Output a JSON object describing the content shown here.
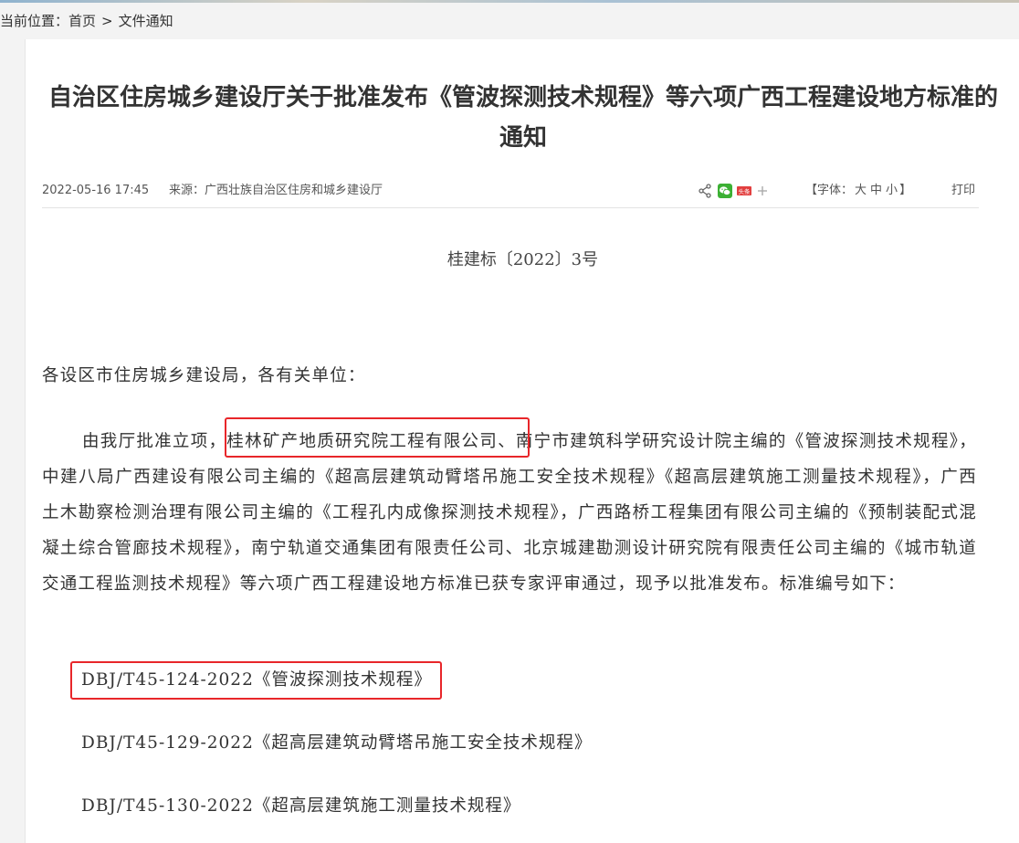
{
  "breadcrumb": {
    "label": "当前位置：",
    "home": "首页",
    "separator": ">",
    "current": "文件通知"
  },
  "article": {
    "title": "自治区住房城乡建设厅关于批准发布《管波探测技术规程》等六项广西工程建设地方标准的通知",
    "date": "2022-05-16 17:45",
    "source": "来源：广西壮族自治区住房和城乡建设厅",
    "font_size": {
      "open": "【字体：",
      "large": "大",
      "medium": "中",
      "small": "小",
      "close": "】"
    },
    "print": "打印",
    "doc_number": "桂建标〔2022〕3号",
    "salutation": "各设区市住房城乡建设局，各有关单位：",
    "paragraph": "由我厅批准立项，桂林矿产地质研究院工程有限公司、南宁市建筑科学研究设计院主编的《管波探测技术规程》，中建八局广西建设有限公司主编的《超高层建筑动臂塔吊施工安全技术规程》《超高层建筑施工测量技术规程》，广西土木勘察检测治理有限公司主编的《工程孔内成像探测技术规程》，广西路桥工程集团有限公司主编的《预制装配式混凝土综合管廊技术规程》，南宁轨道交通集团有限责任公司、北京城建勘测设计研究院有限责任公司主编的《城市轨道交通工程监测技术规程》等六项广西工程建设地方标准已获专家评审通过，现予以批准发布。标准编号如下：",
    "standards": [
      "DBJ/T45-124-2022《管波探测技术规程》",
      "DBJ/T45-129-2022《超高层建筑动臂塔吊施工安全技术规程》",
      "DBJ/T45-130-2022《超高层建筑施工测量技术规程》"
    ]
  },
  "share": {
    "icons": [
      "share-icon",
      "wechat-icon",
      "toutiao-icon",
      "plus-icon"
    ],
    "toutiao_text": "头条"
  },
  "colors": {
    "highlight_box": "#e8262a",
    "wechat": "#3cb034",
    "toutiao": "#e23f3f"
  }
}
